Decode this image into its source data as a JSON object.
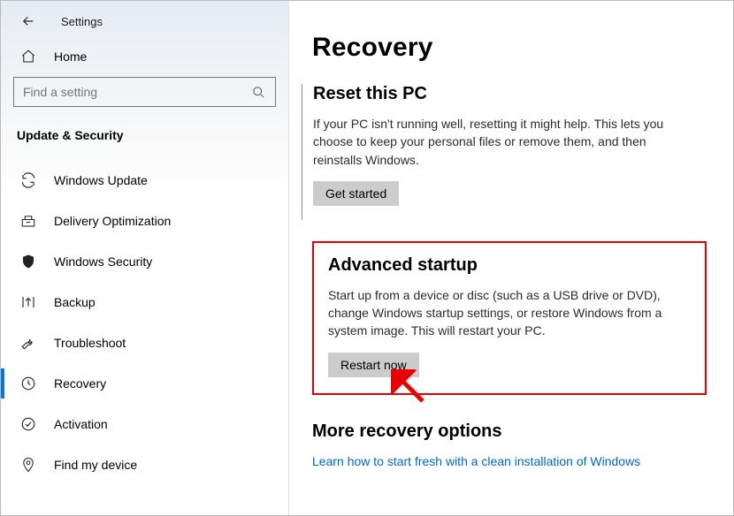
{
  "titlebar": {
    "label": "Settings"
  },
  "home": {
    "label": "Home"
  },
  "search": {
    "placeholder": "Find a setting"
  },
  "section_header": "Update & Security",
  "nav": [
    {
      "label": "Windows Update"
    },
    {
      "label": "Delivery Optimization"
    },
    {
      "label": "Windows Security"
    },
    {
      "label": "Backup"
    },
    {
      "label": "Troubleshoot"
    },
    {
      "label": "Recovery"
    },
    {
      "label": "Activation"
    },
    {
      "label": "Find my device"
    }
  ],
  "page": {
    "title": "Recovery",
    "reset": {
      "title": "Reset this PC",
      "body": "If your PC isn't running well, resetting it might help. This lets you choose to keep your personal files or remove them, and then reinstalls Windows.",
      "button": "Get started"
    },
    "advanced": {
      "title": "Advanced startup",
      "body": "Start up from a device or disc (such as a USB drive or DVD), change Windows startup settings, or restore Windows from a system image. This will restart your PC.",
      "button": "Restart now"
    },
    "more": {
      "title": "More recovery options",
      "link": "Learn how to start fresh with a clean installation of Windows"
    }
  }
}
